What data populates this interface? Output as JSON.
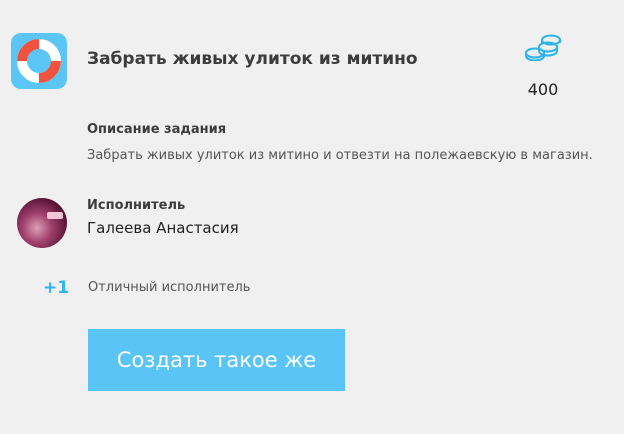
{
  "task": {
    "title": "Забрать живых улиток из митино",
    "icon": "lifebuoy-icon"
  },
  "reward": {
    "icon": "coins-icon",
    "amount": "400"
  },
  "description": {
    "heading": "Описание задания",
    "text": "Забрать живых улиток из митино и отвезти на полежаевскую в магазин."
  },
  "performer": {
    "heading": "Исполнитель",
    "name": "Галеева Анастасия"
  },
  "rating": {
    "score": "+1",
    "text": "Отличный исполнитель"
  },
  "actions": {
    "create_label": "Создать такое же"
  },
  "colors": {
    "accent": "#5bc4f7",
    "rating": "#2bb5ec",
    "background": "#f0f0f0"
  }
}
